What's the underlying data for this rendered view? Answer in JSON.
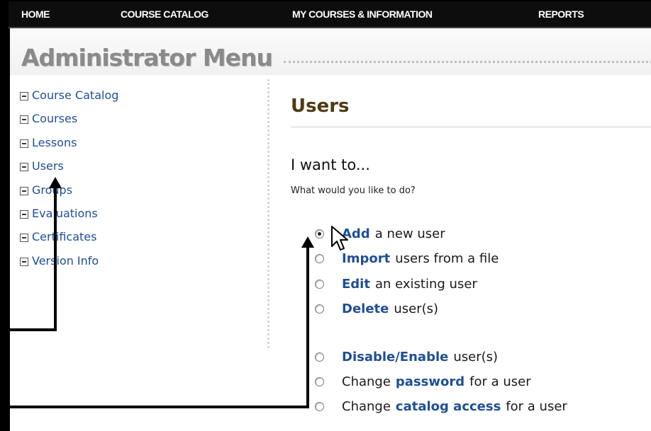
{
  "nav": {
    "items": [
      "HOME",
      "COURSE CATALOG",
      "MY COURSES & INFORMATION",
      "REPORTS"
    ]
  },
  "header": {
    "title": "Administrator Menu"
  },
  "sidebar": {
    "items": [
      {
        "label": "Course Catalog"
      },
      {
        "label": "Courses"
      },
      {
        "label": "Lessons"
      },
      {
        "label": "Users"
      },
      {
        "label": "Groups"
      },
      {
        "label": "Evaluations"
      },
      {
        "label": "Certificates"
      },
      {
        "label": "Version Info"
      }
    ]
  },
  "main": {
    "title": "Users",
    "subtitle": "I want to...",
    "prompt": "What would you like to do?",
    "options": [
      {
        "bold": "Add",
        "after": "a new user",
        "checked": true
      },
      {
        "bold": "Import",
        "after": "users from a file",
        "checked": false
      },
      {
        "bold": "Edit",
        "after": "an existing user",
        "checked": false
      },
      {
        "bold": "Delete",
        "after": "user(s)",
        "checked": false
      },
      {
        "bold": "Disable/Enable",
        "after": "user(s)",
        "checked": false
      },
      {
        "before": "Change",
        "bold": "password",
        "after": "for a user",
        "checked": false
      },
      {
        "before": "Change",
        "bold": "catalog access",
        "after": "for a user",
        "checked": false
      }
    ]
  },
  "colors": {
    "link": "#1f4e96",
    "title_brown": "#4f3a12",
    "nav_bg": "#0d0d0d"
  }
}
